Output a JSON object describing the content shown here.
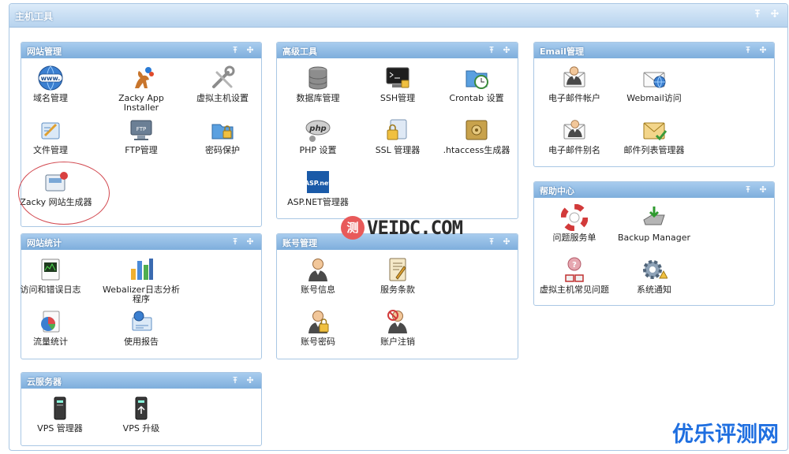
{
  "header": {
    "title": "主机工具"
  },
  "panels": {
    "website": {
      "title": "网站管理",
      "items": [
        "域名管理",
        "Zacky App Installer",
        "虚拟主机设置",
        "文件管理",
        "FTP管理",
        "密码保护",
        "Zacky 网站生成器"
      ]
    },
    "advanced": {
      "title": "高级工具",
      "items": [
        "数据库管理",
        "SSH管理",
        "Crontab 设置",
        "PHP 设置",
        "SSL 管理器",
        ".htaccess生成器",
        "ASP.NET管理器"
      ]
    },
    "email": {
      "title": "Email管理",
      "items": [
        "电子邮件帐户",
        "Webmail访问",
        "电子邮件别名",
        "邮件列表管理器"
      ]
    },
    "help": {
      "title": "帮助中心",
      "items": [
        "问题服务单",
        "Backup Manager",
        "虚拟主机常见问题",
        "系统通知"
      ]
    },
    "stats": {
      "title": "网站统计",
      "items": [
        "访问和错误日志",
        "Webalizer日志分析程序",
        "流量统计",
        "使用报告"
      ]
    },
    "account": {
      "title": "账号管理",
      "items": [
        "账号信息",
        "服务条款",
        "账号密码",
        "账户注销"
      ]
    },
    "cloud": {
      "title": "云服务器",
      "items": [
        "VPS 管理器",
        "VPS 升级"
      ]
    }
  },
  "icon_text": {
    "php": "php",
    "aspnet": "ASP.net",
    "ftp": "FTP",
    "www": "www."
  },
  "watermark": {
    "badge": "测",
    "center": "VEIDC.COM",
    "corner": "优乐评测网"
  },
  "colors": {
    "header_gradient_top": "#dcebf9",
    "panel_header": "#8fbbe6",
    "border": "#a9c7e4",
    "watermark_blue": "#1f6fe0",
    "highlight_red": "#d2484f"
  }
}
